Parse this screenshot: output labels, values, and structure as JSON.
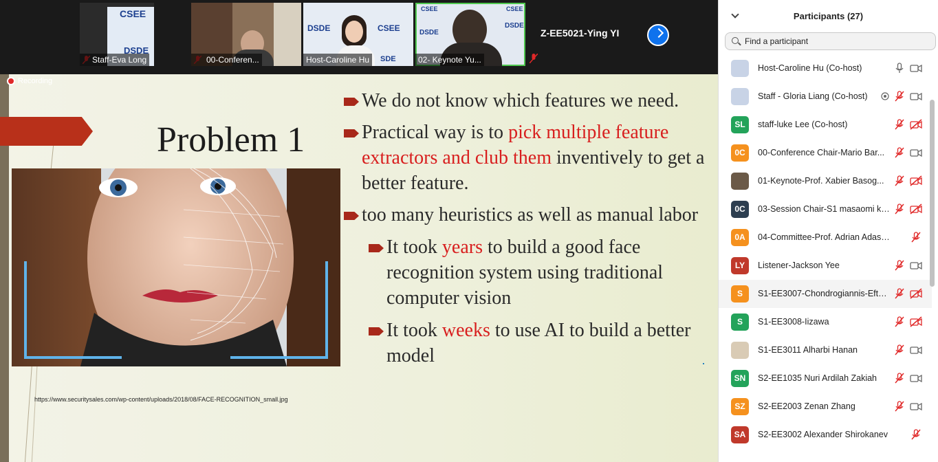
{
  "gallery": {
    "tiles": [
      {
        "name": "Staff-Eva Long",
        "logo_top": "CSEE",
        "logo_bottom": "DSDE"
      },
      {
        "name": "00-Conferen..."
      },
      {
        "name": "Host-Caroline Hu",
        "logo_top": "DSDE",
        "logo_right": "CSEE",
        "logo_bottom": "SDE"
      },
      {
        "name": "02- Keynote Yu...",
        "logo_top": "CSEE",
        "logo_mid": "DSDE",
        "logo_right": "CSEE",
        "logo_right2": "DSDE"
      }
    ],
    "active_speaker": "Z-EE5021-Ying YI"
  },
  "recording": {
    "label": "Recording"
  },
  "slide": {
    "title": "Problem 1",
    "image_url": "https://www.securitysales.com/wp-content/uploads/2018/08/FACE-RECOGNITION_small.jpg",
    "bullets": [
      {
        "a": "We do not know which features we need."
      },
      {
        "a": "Practical way is to ",
        "b": "pick multiple feature extractors and club them",
        "c": " inventively to get a better feature."
      },
      {
        "a": "too many heuristics as well as manual labor"
      }
    ],
    "subbullets": [
      {
        "a": "It took ",
        "b": "years",
        "c": " to build a good face recognition system using traditional computer vision"
      },
      {
        "a": "It took ",
        "b": "weeks",
        "c": " to use AI to build a better model"
      }
    ]
  },
  "participants": {
    "title": "Participants (27)",
    "search_placeholder": "Find a participant",
    "rows": [
      {
        "name": "Host-Caroline Hu (Co-host)",
        "avatar": "",
        "color": "#c8d3e6",
        "mic": "on",
        "cam": "on"
      },
      {
        "name": "Staff - Gloria Liang (Co-host)",
        "avatar": "",
        "color": "#c8d3e6",
        "mic": "off",
        "cam": "on",
        "share": true
      },
      {
        "name": "staff-luke Lee (Co-host)",
        "avatar": "SL",
        "color": "#23a35a",
        "mic": "off",
        "cam": "off"
      },
      {
        "name": "00-Conference Chair-Mario Bar...",
        "avatar": "0C",
        "color": "#f5911e",
        "mic": "off",
        "cam": "on"
      },
      {
        "name": "01-Keynote-Prof. Xabier Basog...",
        "avatar": "",
        "color": "#6b5a48",
        "mic": "off",
        "cam": "off"
      },
      {
        "name": "03-Session Chair-S1 masaomi ki...",
        "avatar": "0C",
        "color": "#2d3e50",
        "mic": "off",
        "cam": "off"
      },
      {
        "name": "04-Committee-Prof. Adrian Adascali...",
        "avatar": "0A",
        "color": "#f5911e",
        "mic": "off",
        "cam": ""
      },
      {
        "name": "Listener-Jackson Yee",
        "avatar": "LY",
        "color": "#c0392b",
        "mic": "off",
        "cam": "on"
      },
      {
        "name": "S1-EE3007-Chondrogiannis-Efth...",
        "avatar": "S",
        "color": "#f5911e",
        "mic": "off",
        "cam": "off"
      },
      {
        "name": "S1-EE3008-Iizawa",
        "avatar": "S",
        "color": "#23a35a",
        "mic": "off",
        "cam": "off"
      },
      {
        "name": "S1-EE3011 Alharbi Hanan",
        "avatar": "",
        "color": "#d9cbb5",
        "mic": "off",
        "cam": "on"
      },
      {
        "name": "S2-EE1035 Nuri Ardilah Zakiah",
        "avatar": "SN",
        "color": "#23a35a",
        "mic": "off",
        "cam": "on"
      },
      {
        "name": "S2-EE2003 Zenan Zhang",
        "avatar": "SZ",
        "color": "#f5911e",
        "mic": "off",
        "cam": "on"
      },
      {
        "name": "S2-EE3002 Alexander Shirokanev",
        "avatar": "SA",
        "color": "#c0392b",
        "mic": "off",
        "cam": ""
      }
    ]
  }
}
